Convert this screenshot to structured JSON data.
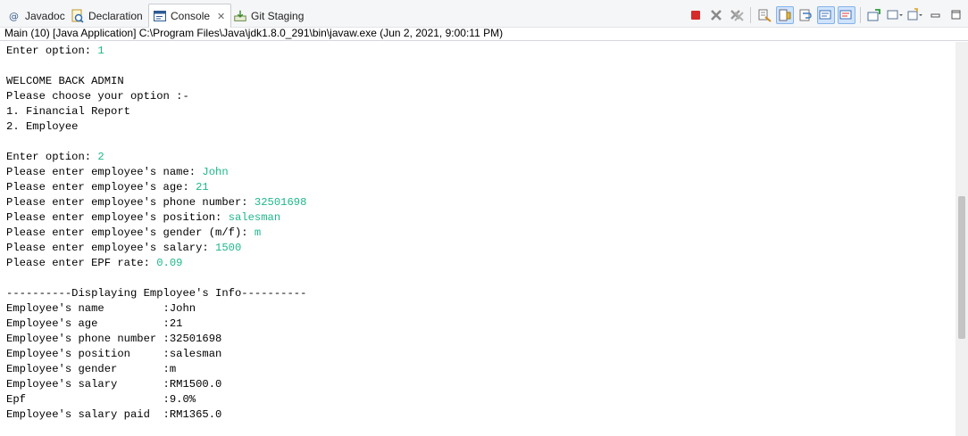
{
  "tabs": [
    {
      "label": "Javadoc",
      "icon": "at-icon"
    },
    {
      "label": "Declaration",
      "icon": "declaration-icon"
    },
    {
      "label": "Console",
      "icon": "console-icon",
      "active": true
    },
    {
      "label": "Git Staging",
      "icon": "git-staging-icon"
    }
  ],
  "tab_close_glyph": "✕",
  "toolbar": {
    "buttons": [
      "terminate-icon",
      "remove-launch-icon",
      "remove-all-terminated-icon",
      "clear-console-icon",
      "scroll-lock-icon",
      "word-wrap-icon",
      "show-on-stdout-icon",
      "show-on-stderr-icon",
      "pin-console-icon",
      "display-selected-console-icon",
      "open-console-icon",
      "minimize-icon",
      "maximize-icon"
    ]
  },
  "console": {
    "description": "Main (10) [Java Application] C:\\Program Files\\Java\\jdk1.8.0_291\\bin\\javaw.exe  (Jun 2, 2021, 9:00:11 PM)",
    "lines": [
      {
        "prompt": "Enter option: ",
        "input": "1"
      },
      {
        "prompt": "",
        "input": ""
      },
      {
        "prompt": "WELCOME BACK ADMIN",
        "input": ""
      },
      {
        "prompt": "Please choose your option :-",
        "input": ""
      },
      {
        "prompt": "1. Financial Report",
        "input": ""
      },
      {
        "prompt": "2. Employee",
        "input": ""
      },
      {
        "prompt": "",
        "input": ""
      },
      {
        "prompt": "Enter option: ",
        "input": "2"
      },
      {
        "prompt": "Please enter employee's name: ",
        "input": "John"
      },
      {
        "prompt": "Please enter employee's age: ",
        "input": "21"
      },
      {
        "prompt": "Please enter employee's phone number: ",
        "input": "32501698"
      },
      {
        "prompt": "Please enter employee's position: ",
        "input": "salesman"
      },
      {
        "prompt": "Please enter employee's gender (m/f): ",
        "input": "m"
      },
      {
        "prompt": "Please enter employee's salary: ",
        "input": "1500"
      },
      {
        "prompt": "Please enter EPF rate: ",
        "input": "0.09"
      },
      {
        "prompt": "",
        "input": ""
      },
      {
        "prompt": "----------Displaying Employee's Info----------",
        "input": ""
      },
      {
        "prompt": "Employee's name         :John",
        "input": ""
      },
      {
        "prompt": "Employee's age          :21",
        "input": ""
      },
      {
        "prompt": "Employee's phone number :32501698",
        "input": ""
      },
      {
        "prompt": "Employee's position     :salesman",
        "input": ""
      },
      {
        "prompt": "Employee's gender       :m",
        "input": ""
      },
      {
        "prompt": "Employee's salary       :RM1500.0",
        "input": ""
      },
      {
        "prompt": "Epf                     :9.0%",
        "input": ""
      },
      {
        "prompt": "Employee's salary paid  :RM1365.0",
        "input": ""
      }
    ]
  }
}
